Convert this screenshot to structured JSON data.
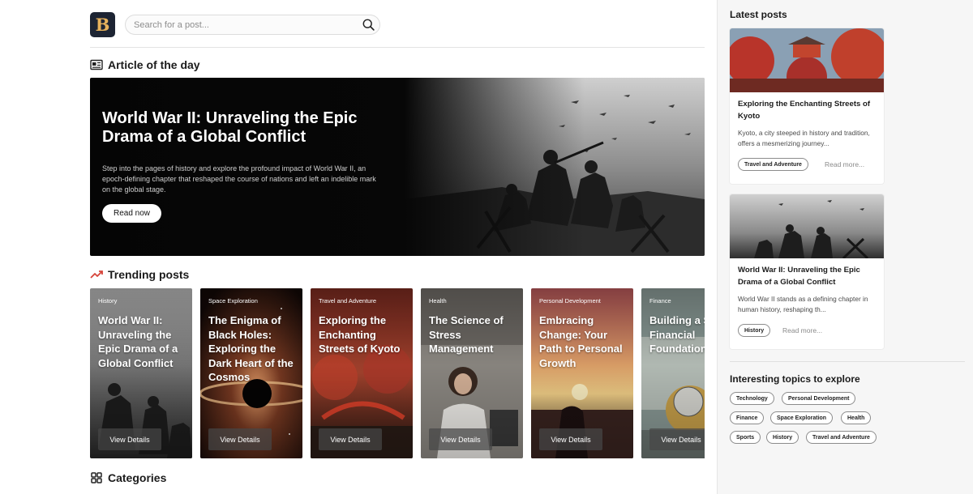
{
  "header": {
    "logo_letter": "B",
    "search": {
      "placeholder": "Search for a post..."
    }
  },
  "article_of_day": {
    "section_title": "Article of the day",
    "title": "World War II: Unraveling the Epic Drama of a Global Conflict",
    "description": "Step into the pages of history and explore the profound impact of World War II, an epoch-defining chapter that reshaped the course of nations and left an indelible mark on the global stage.",
    "button_label": "Read now"
  },
  "trending": {
    "section_title": "Trending posts",
    "cards": [
      {
        "category": "History",
        "title": "World War II: Unraveling the Epic Drama of a Global Conflict",
        "button": "View Details",
        "image": "soldiers-battle"
      },
      {
        "category": "Space Exploration",
        "title": "The Enigma of Black Holes: Exploring the Dark Heart of the Cosmos",
        "button": "View Details",
        "image": "black-hole"
      },
      {
        "category": "Travel and Adventure",
        "title": "Exploring the Enchanting Streets of Kyoto",
        "button": "View Details",
        "image": "kyoto-bridge"
      },
      {
        "category": "Health",
        "title": "The Science of Stress Management",
        "button": "View Details",
        "image": "stressed-woman"
      },
      {
        "category": "Personal Development",
        "title": "Embracing Change: Your Path to Personal Growth",
        "button": "View Details",
        "image": "sunset-sea"
      },
      {
        "category": "Finance",
        "title": "Building a Solid Financial Foundation",
        "button": "View Details",
        "image": "money-coins"
      }
    ]
  },
  "categories": {
    "section_title": "Categories"
  },
  "sidebar": {
    "latest_title": "Latest posts",
    "posts": [
      {
        "title": "Exploring the Enchanting Streets of Kyoto",
        "excerpt": "Kyoto, a city steeped in history and tradition, offers a mesmerizing journey...",
        "tag": "Travel and Adventure",
        "more": "Read more..."
      },
      {
        "title": "World War II: Unraveling the Epic Drama of a Global Conflict",
        "excerpt": "World War II stands as a defining chapter in human history, reshaping th...",
        "tag": "History",
        "more": "Read more..."
      }
    ],
    "topics_title": "Interesting topics to explore",
    "topics": [
      "Technology",
      "Personal Development",
      "Finance",
      "Space Exploration",
      "Health",
      "Sports",
      "History",
      "Travel and Adventure"
    ]
  },
  "colors": {
    "logo_bg": "#1d2433",
    "logo_letter": "#e7b25c",
    "trending_icon": "#d6443a",
    "sidebar_bg": "#f6f6f6"
  }
}
